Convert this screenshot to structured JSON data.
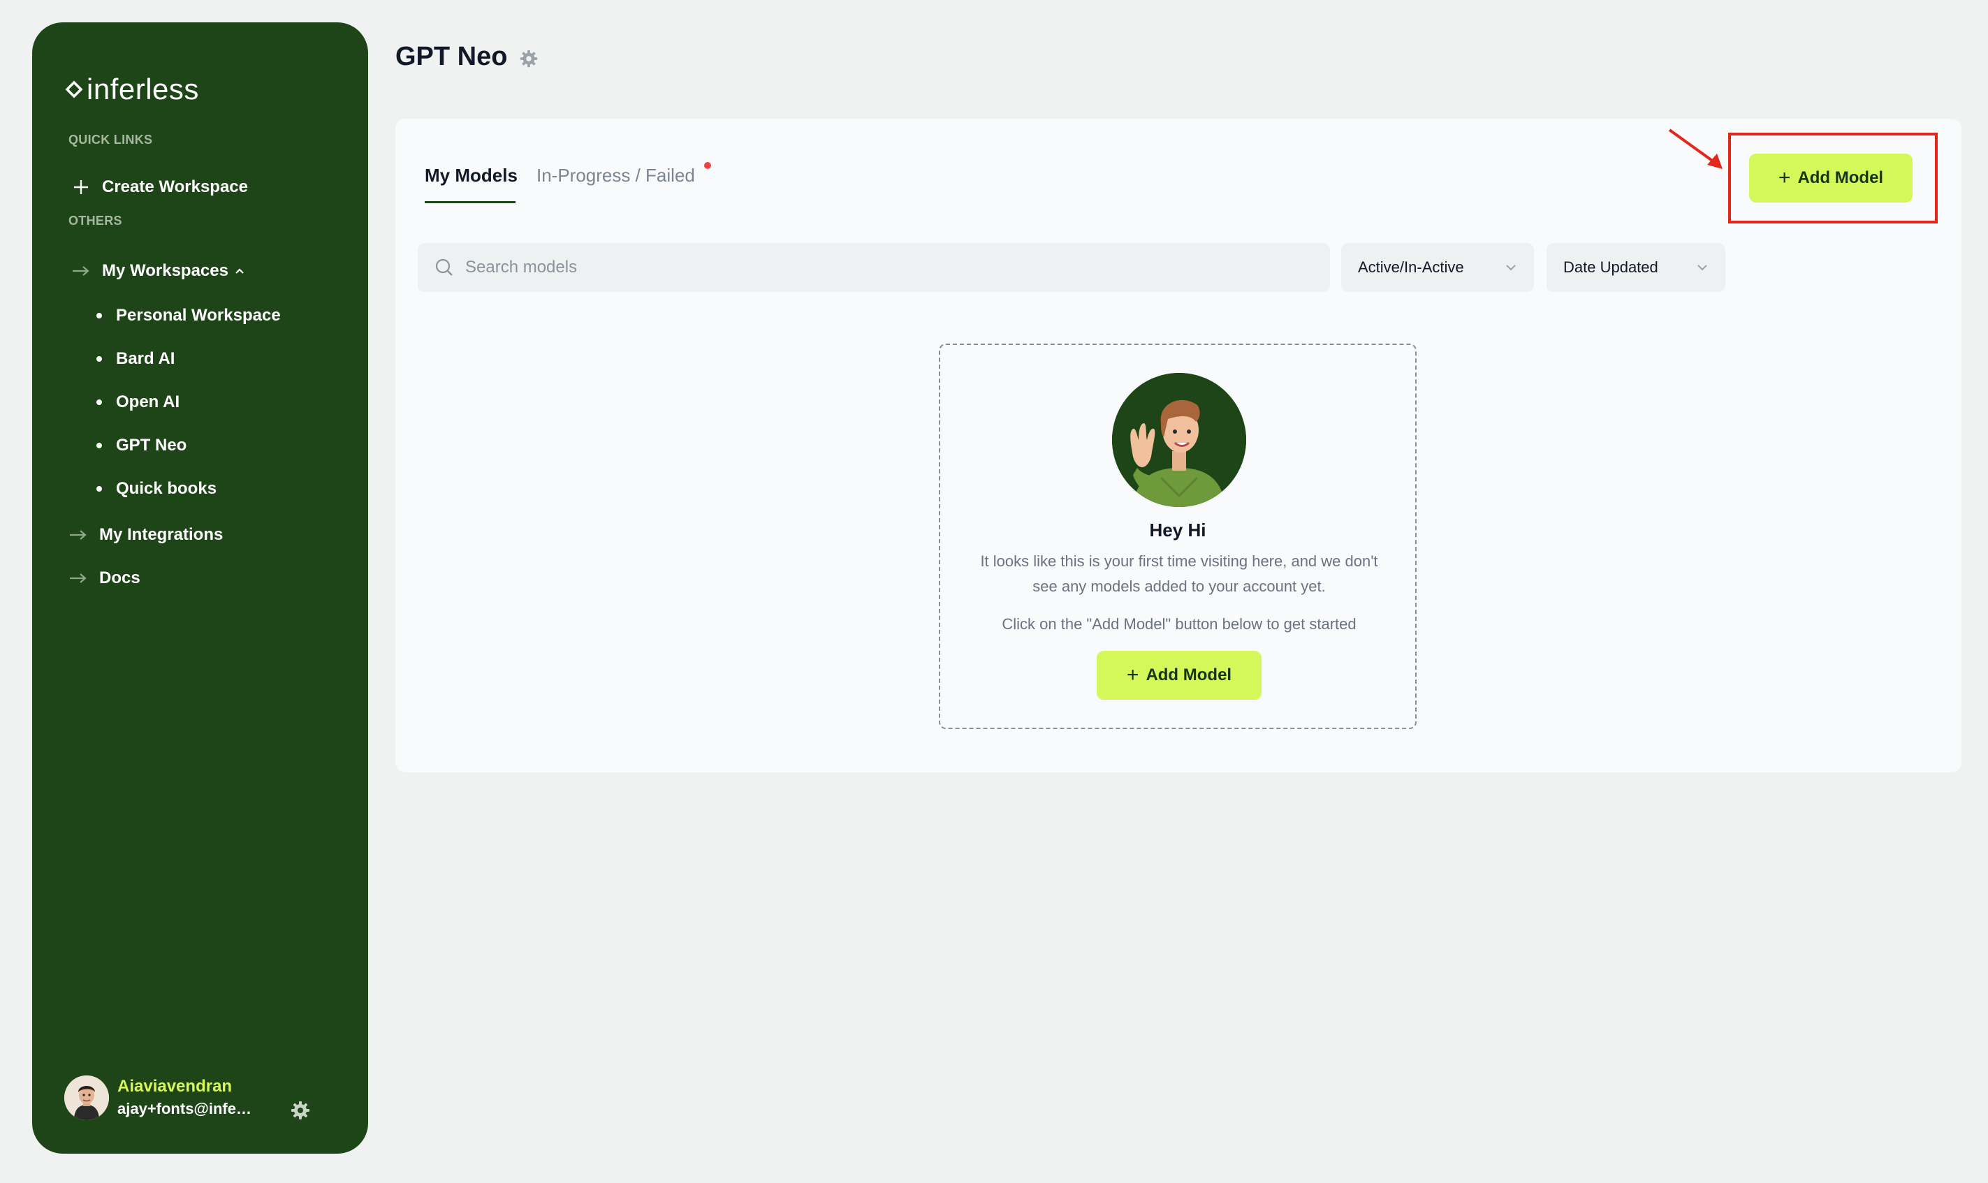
{
  "brand": {
    "name": "inferless"
  },
  "sidebar": {
    "quick_links_label": "QUICK LINKS",
    "create_workspace": "Create Workspace",
    "others_label": "OTHERS",
    "my_workspaces": "My Workspaces",
    "workspaces": [
      "Personal Workspace",
      "Bard AI",
      "Open AI",
      "GPT Neo",
      "Quick books"
    ],
    "my_integrations": "My Integrations",
    "docs": "Docs"
  },
  "profile": {
    "name": "Aiaviavendran",
    "email": "ajay+fonts@inferless.com"
  },
  "page": {
    "title": "GPT Neo"
  },
  "tabs": {
    "active": "My Models",
    "inactive": "In-Progress / Failed"
  },
  "toolbar": {
    "add_model_label": "Add Model",
    "search_placeholder": "Search models",
    "status_filter": "Active/In-Active",
    "sort_filter": "Date Updated"
  },
  "empty_state": {
    "title": "Hey Hi",
    "message": "It looks like this is your first time visiting here, and we don't see any models added to your account yet.",
    "hint": "Click on the \"Add Model\" button below to get started",
    "button_label": "Add Model"
  },
  "colors": {
    "sidebar": "#1e4518",
    "accent": "#d4f85a",
    "highlight": "#e5261a",
    "notification": "#ef4444"
  }
}
